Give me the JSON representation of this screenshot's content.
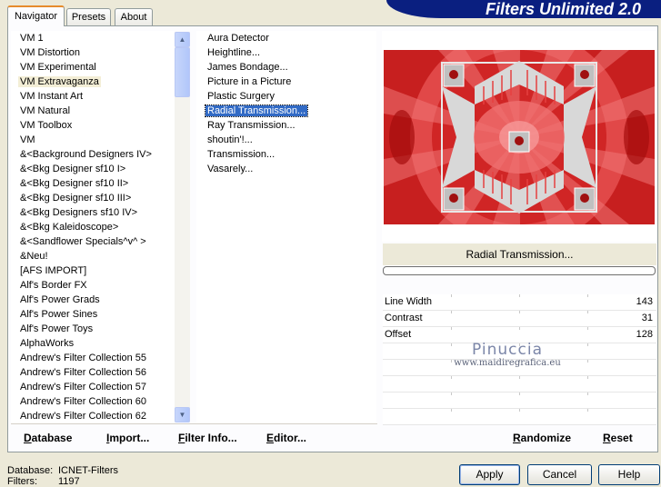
{
  "app": {
    "title": "Filters Unlimited 2.0"
  },
  "tabs": [
    {
      "label": "Navigator",
      "active": true
    },
    {
      "label": "Presets",
      "active": false
    },
    {
      "label": "About",
      "active": false
    }
  ],
  "categories": {
    "selected_index": 3,
    "items": [
      "VM 1",
      "VM Distortion",
      "VM Experimental",
      "VM Extravaganza",
      "VM Instant Art",
      "VM Natural",
      "VM Toolbox",
      "VM",
      "&<Background Designers IV>",
      "&<Bkg Designer sf10 I>",
      "&<Bkg Designer sf10 II>",
      "&<Bkg Designer sf10 III>",
      "&<Bkg Designers sf10 IV>",
      "&<Bkg Kaleidoscope>",
      "&<Sandflower Specials^v^ >",
      "&Neu!",
      "[AFS IMPORT]",
      "Alf's Border FX",
      "Alf's Power Grads",
      "Alf's Power Sines",
      "Alf's Power Toys",
      "AlphaWorks",
      "Andrew's Filter Collection 55",
      "Andrew's Filter Collection 56",
      "Andrew's Filter Collection 57",
      "Andrew's Filter Collection 60",
      "Andrew's Filter Collection 62"
    ]
  },
  "filters": {
    "selected_index": 5,
    "items": [
      "Aura Detector",
      "Heightline...",
      "James Bondage...",
      "Picture in a Picture",
      "Plastic Surgery",
      "Radial Transmission...",
      "Ray Transmission...",
      "shoutin'!...",
      "Transmission...",
      "Vasarely..."
    ]
  },
  "preview": {
    "filter_name": "Radial Transmission...",
    "colors": {
      "red": "#d42b2b",
      "light_red": "#ee6a6a",
      "dark_red": "#b00d0d",
      "gray": "#bdbdbd"
    }
  },
  "params": [
    {
      "label": "Line Width",
      "value": "143",
      "fraction": 0.56
    },
    {
      "label": "Contrast",
      "value": "31",
      "fraction": 0.12
    },
    {
      "label": "Offset",
      "value": "128",
      "fraction": 0.5
    }
  ],
  "watermark": {
    "title": "Pinuccia",
    "sub": "www.maidiregrafica.eu"
  },
  "bottom_bar": {
    "database": "Database",
    "import": "Import...",
    "filter_info": "Filter Info...",
    "editor": "Editor...",
    "randomize": "Randomize",
    "reset": "Reset"
  },
  "status": {
    "database_label": "Database:",
    "database_value": "ICNET-Filters",
    "filters_label": "Filters:",
    "filters_value": "1197"
  },
  "dialog_buttons": {
    "apply": "Apply",
    "cancel": "Cancel",
    "help": "Help"
  },
  "icons": {
    "scroll_up": "chevron-up-icon",
    "scroll_down": "chevron-down-icon"
  }
}
